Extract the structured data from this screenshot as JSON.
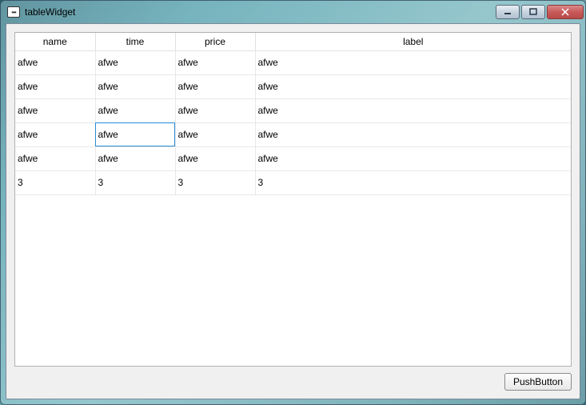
{
  "window": {
    "title": "tableWidget"
  },
  "table": {
    "headers": [
      "name",
      "time",
      "price",
      "label"
    ],
    "rows": [
      [
        "afwe",
        "afwe",
        "afwe",
        "afwe"
      ],
      [
        "afwe",
        "afwe",
        "afwe",
        "afwe"
      ],
      [
        "afwe",
        "afwe",
        "afwe",
        "afwe"
      ],
      [
        "afwe",
        "afwe",
        "afwe",
        "afwe"
      ],
      [
        "afwe",
        "afwe",
        "afwe",
        "afwe"
      ],
      [
        "3",
        "3",
        "3",
        "3"
      ]
    ],
    "selected": {
      "row": 3,
      "col": 1
    }
  },
  "button": {
    "label": "PushButton"
  }
}
